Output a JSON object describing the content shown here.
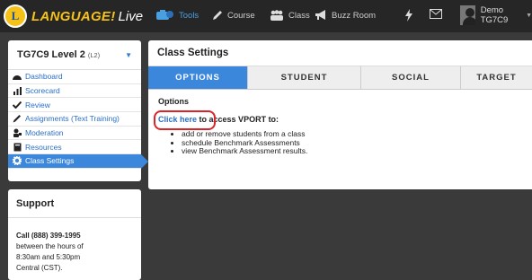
{
  "app": {
    "logo_mark": "L",
    "logo_text": "LANGUAGE!",
    "logo_sub": "Live"
  },
  "nav": {
    "tools": "Tools",
    "course": "Course",
    "class": "Class",
    "buzz_room": "Buzz Room"
  },
  "user": {
    "name": "Demo TG7C9"
  },
  "sidebar": {
    "course": "TG7C9 Level 2",
    "level": "(L2)",
    "items": [
      {
        "label": "Dashboard",
        "icon": "dashboard-icon"
      },
      {
        "label": "Scorecard",
        "icon": "bar-chart-icon"
      },
      {
        "label": "Review",
        "icon": "check-icon"
      },
      {
        "label": "Assignments (Text Training)",
        "icon": "pencil-icon"
      },
      {
        "label": "Moderation",
        "icon": "moderation-icon"
      },
      {
        "label": "Resources",
        "icon": "book-icon"
      },
      {
        "label": "Class Settings",
        "icon": "gear-icon"
      }
    ]
  },
  "support": {
    "title": "Support",
    "phone": "Call (888) 399-1995",
    "line2": "between the hours of",
    "line3": "8:30am and 5:30pm",
    "line4": "Central (CST)."
  },
  "main": {
    "title": "Class Settings",
    "tabs": [
      "OPTIONS",
      "STUDENT",
      "SOCIAL",
      "TARGET"
    ],
    "options_heading": "Options",
    "link_text": "Click here",
    "link_suffix": " to access VPORT to:",
    "bullets": [
      "add or remove students from a class",
      "schedule Benchmark Assessments",
      "view Benchmark Assessment results."
    ]
  },
  "colors": {
    "accent": "#3b87dc",
    "brand_yellow": "#f6c21a",
    "highlight_red": "#d9252a",
    "topbar": "#262626"
  }
}
